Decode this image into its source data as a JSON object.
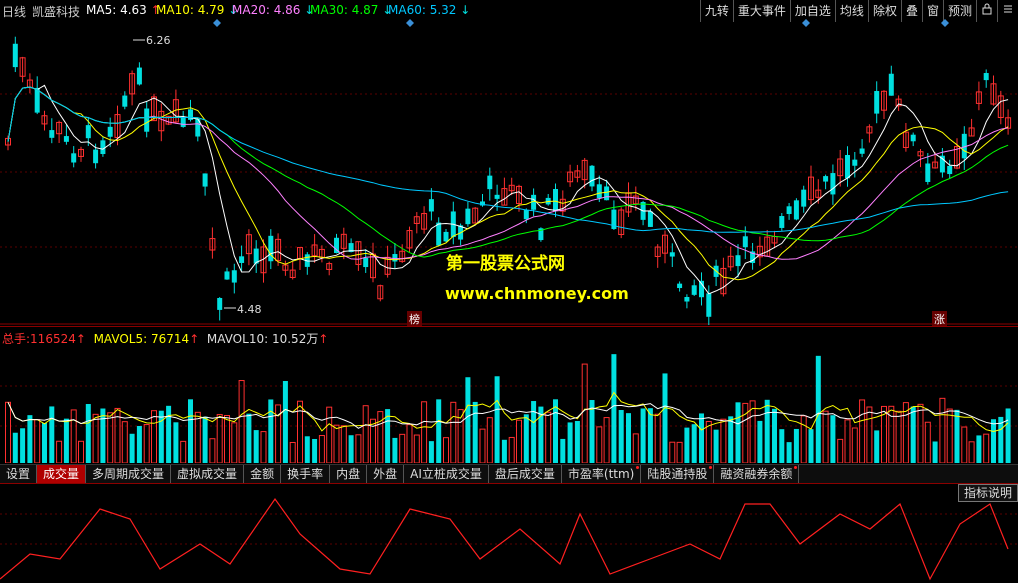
{
  "header": {
    "period": "日线",
    "stock_name": "凯盛科技",
    "ma": [
      {
        "label": "MA5",
        "value": "4.63",
        "dir": "↑",
        "color": "#ffffff"
      },
      {
        "label": "MA10",
        "value": "4.79",
        "dir": "↓",
        "color": "#ffff00"
      },
      {
        "label": "MA20",
        "value": "4.86",
        "dir": "↓",
        "color": "#ff80ff"
      },
      {
        "label": "MA30",
        "value": "4.87",
        "dir": "↓",
        "color": "#00ff00"
      },
      {
        "label": "MA60",
        "value": "5.32",
        "dir": "↓",
        "color": "#00c8ff"
      }
    ]
  },
  "toolbar": {
    "buttons": [
      "九转",
      "重大事件",
      "加自选",
      "均线",
      "除权",
      "叠",
      "窗",
      "预测"
    ],
    "lock_icon": "lock-icon",
    "menu_icon": "menu-icon"
  },
  "price_chart": {
    "high_label": "6.26",
    "low_label": "4.48",
    "tags": [
      "榜",
      "涨"
    ]
  },
  "watermark": {
    "line1": "第一股票公式网",
    "line2": "www.chnmoney.com"
  },
  "volume": {
    "total_label": "总手:",
    "total_value": "116524",
    "mavol5_label": "MAVOL5:",
    "mavol5_value": "76714",
    "mavol10_label": "MAVOL10:",
    "mavol10_value": "10.52万"
  },
  "tabs": [
    {
      "label": "设置",
      "active": false,
      "dot": false
    },
    {
      "label": "成交量",
      "active": true,
      "dot": false
    },
    {
      "label": "多周期成交量",
      "active": false,
      "dot": false
    },
    {
      "label": "虚拟成交量",
      "active": false,
      "dot": false
    },
    {
      "label": "金额",
      "active": false,
      "dot": false
    },
    {
      "label": "换手率",
      "active": false,
      "dot": false
    },
    {
      "label": "内盘",
      "active": false,
      "dot": false
    },
    {
      "label": "外盘",
      "active": false,
      "dot": false
    },
    {
      "label": "AI立桩成交量",
      "active": false,
      "dot": false
    },
    {
      "label": "盘后成交量",
      "active": false,
      "dot": false
    },
    {
      "label": "市盈率(ttm)",
      "active": false,
      "dot": true
    },
    {
      "label": "陆股通持股",
      "active": false,
      "dot": true
    },
    {
      "label": "融资融券余额",
      "active": false,
      "dot": true
    }
  ],
  "indicator_button": "指标说明",
  "colors": {
    "up": "#ff3030",
    "down": "#00e0e0",
    "grid": "#8b0000",
    "background": "#000000"
  }
}
